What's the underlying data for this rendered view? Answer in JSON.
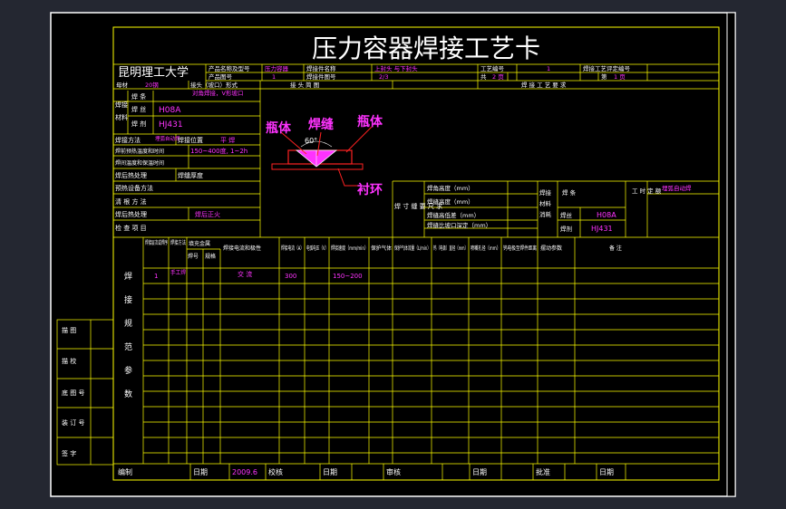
{
  "title": "压力容器焊接工艺卡",
  "university": "昆明理工大学",
  "header": {
    "product_name_label": "产品名称及型号",
    "product_name_value": "压力容器",
    "part_name_label": "焊接件名称",
    "part_name_value": "上封头 与下封头",
    "process_no_label": "工艺编号",
    "process_no_value": "1",
    "eval_no_label": "焊接工艺评定编号",
    "product_fig_label": "产品图号",
    "product_fig_value": "1",
    "part_fig_label": "焊接件图号",
    "part_fig_value": "2/3",
    "total_label": "共",
    "total_value": "2 页",
    "page_label": "第",
    "page_value": "1 页",
    "material_label": "母材",
    "material_value": "20钢",
    "joint_label": "接头（坡口）形式",
    "joint_value": "对角焊接，V形坡口",
    "sketch_label": "接 头 简 图",
    "requirements_label": "焊 接 工 艺 要 求"
  },
  "left_params": {
    "weld_material_label_1": "焊接",
    "weld_material_label_2": "材料",
    "wire_label": "焊 条",
    "diameter_label": "焊 丝",
    "diameter_value": "H08A",
    "flux_label": "焊 剂",
    "flux_value": "HJ431",
    "method_label": "焊接方法",
    "method_value": "埋弧自动焊",
    "position_label": "焊接位置",
    "position_value": "平 焊",
    "preheat_label": "焊前预热温度和时间",
    "preheat_value": "150~400度, 1~2h",
    "interpass_label": "焊间温度和保温时间",
    "postheat_label": "焊后热处理",
    "thickness_label": "焊缝厚度",
    "backing_label": "预热设备方法",
    "backing2_label": "清 根 方 法",
    "heat_treatment_label": "焊后热处理",
    "heat_treatment_value": "焊后正火",
    "inspect_label": "检 查 项 目"
  },
  "sketch": {
    "label_bottle_left": "瓶体",
    "label_weld": "焊缝",
    "label_bottle_right": "瓶体",
    "label_ring": "衬环",
    "angle": "60°"
  },
  "right_block": {
    "size_label": "焊 寸 缝 要 尺 求",
    "rows": [
      "焊角高度（mm）",
      "焊缝高度（mm）",
      "焊缝高低差（mm）",
      "焊缝比坡口深定（mm）"
    ],
    "wm_label_1": "焊接",
    "wm_label_2": "材料",
    "wm_label_3": "消耗",
    "wm_wire": "焊 条",
    "wm_wire2": "焊丝",
    "wm_wire_value": "H08A",
    "wm_flux": "焊剂",
    "wm_flux_value": "HJ431",
    "time_label": "工 时 定 额",
    "time_value": "埋弧自动焊"
  },
  "table": {
    "side_label": [
      "焊",
      "接",
      "规",
      "范",
      "参",
      "数"
    ],
    "headers": [
      "焊接层次或焊序",
      "焊接方法",
      "填充金属",
      "焊号",
      "规格",
      "焊接电流和极性",
      "焊接电流（A）",
      "电弧电压（V）",
      "焊接速度（mm/min）",
      "保护气体",
      "保护气体流量（L/min）",
      "钨（电极）直径（mm）",
      "喷嘴孔径（mm）",
      "钨电极至焊件距离",
      "摆动参数",
      "备 注"
    ],
    "row1": {
      "seq": "1",
      "method": "手工焊",
      "current_type": "交 流",
      "current": "300",
      "speed": "150~200"
    }
  },
  "sign_block": {
    "items": [
      "描 图",
      "描 校",
      "底 图 号",
      "装 订 号",
      "签 字"
    ]
  },
  "footer": {
    "compile_label": "编制",
    "date1_label": "日期",
    "date1_value": "2009.6",
    "check_label": "校核",
    "date2_label": "日期",
    "review_label": "审核",
    "date3_label": "日期",
    "approve_label": "批准",
    "date4_label": "日期"
  },
  "colors": {
    "background": "#242731",
    "paper": "#000000",
    "frame": "#ffffff",
    "grid": "#ffff00",
    "text": "#ffffff",
    "value": "#ff33ff",
    "sketch_line": "#ff2222"
  }
}
